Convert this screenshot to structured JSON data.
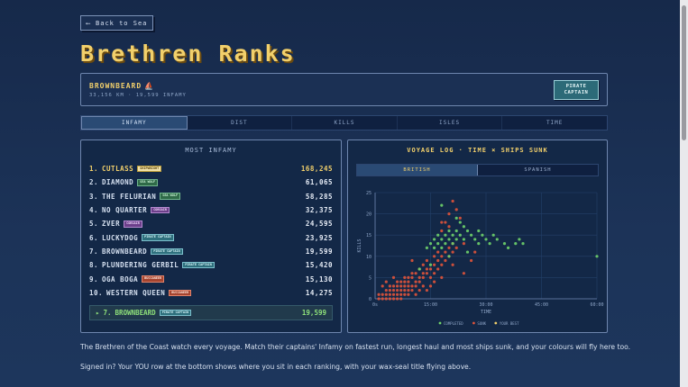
{
  "nav": {
    "back_label": "⟵ Back to Sea"
  },
  "page": {
    "title": "Brethren Ranks"
  },
  "user": {
    "name": "BROWNBEARD",
    "stats": "33,156 KM · 19,599 INFAMY",
    "rank_button": "PIRATE CAPTAIN"
  },
  "tabs": [
    {
      "label": "INFAMY",
      "active": true
    },
    {
      "label": "DIST",
      "active": false
    },
    {
      "label": "KILLS",
      "active": false
    },
    {
      "label": "ISLES",
      "active": false
    },
    {
      "label": "TIME",
      "active": false
    }
  ],
  "leaderboard": {
    "title": "MOST INFAMY",
    "rows": [
      {
        "rank": "1.",
        "name": "CUTLASS",
        "badge": "SHIPWRIGHT",
        "badge_style": "gold",
        "score": "168,245"
      },
      {
        "rank": "2.",
        "name": "DIAMOND",
        "badge": "SEA WOLF",
        "badge_style": "green",
        "score": "61,065"
      },
      {
        "rank": "3.",
        "name": "THE FELURIAN",
        "badge": "SEA WOLF",
        "badge_style": "green",
        "score": "58,285"
      },
      {
        "rank": "4.",
        "name": "NO QUARTER",
        "badge": "CORSAIR",
        "badge_style": "purple",
        "score": "32,375"
      },
      {
        "rank": "5.",
        "name": "ZVER",
        "badge": "CORSAIR",
        "badge_style": "purple",
        "score": "24,595"
      },
      {
        "rank": "6.",
        "name": "LUCKYDOG",
        "badge": "PIRATE CAPTAIN",
        "badge_style": "teal",
        "score": "23,925"
      },
      {
        "rank": "7.",
        "name": "BROWNBEARD",
        "badge": "PIRATE CAPTAIN",
        "badge_style": "teal",
        "score": "19,599"
      },
      {
        "rank": "8.",
        "name": "PLUNDERING GERBIL",
        "badge": "PIRATE CAPTAIN",
        "badge_style": "teal",
        "score": "15,420"
      },
      {
        "rank": "9.",
        "name": "OGA BOGA",
        "badge": "BUCCANEER",
        "badge_style": "red",
        "score": "15,130"
      },
      {
        "rank": "10.",
        "name": "WESTERN QUEEN",
        "badge": "BUCCANEER",
        "badge_style": "red",
        "score": "14,275"
      }
    ],
    "you_row": {
      "marker": "▸",
      "rank": "7.",
      "name": "BROWNBEARD",
      "badge": "PIRATE CAPTAIN",
      "score": "19,599"
    }
  },
  "voyage": {
    "title": "VOYAGE LOG · TIME × SHIPS SUNK",
    "segments": [
      {
        "label": "BRITISH",
        "active": true
      },
      {
        "label": "SPANISH",
        "active": false
      }
    ]
  },
  "chart_data": {
    "type": "scatter",
    "title": "VOYAGE LOG · TIME × SHIPS SUNK",
    "xlabel": "TIME",
    "ylabel": "KILLS",
    "x_ticks": [
      "0s",
      "15:00",
      "30:00",
      "45:00",
      "60:00"
    ],
    "y_ticks": [
      0,
      5,
      10,
      15,
      20,
      25
    ],
    "xlim": [
      0,
      60
    ],
    "ylim": [
      0,
      25
    ],
    "grid": true,
    "legend_placement": "bottom",
    "series": [
      {
        "name": "COMPLETED",
        "color": "#6fd36a",
        "points": [
          [
            14,
            12
          ],
          [
            15,
            13
          ],
          [
            16,
            14
          ],
          [
            16,
            12
          ],
          [
            17,
            13
          ],
          [
            17,
            15
          ],
          [
            18,
            14
          ],
          [
            18,
            12
          ],
          [
            19,
            13
          ],
          [
            19,
            15
          ],
          [
            20,
            14
          ],
          [
            20,
            16
          ],
          [
            21,
            13
          ],
          [
            21,
            15
          ],
          [
            22,
            14
          ],
          [
            22,
            16
          ],
          [
            23,
            15
          ],
          [
            24,
            14
          ],
          [
            24,
            17
          ],
          [
            25,
            16
          ],
          [
            26,
            15
          ],
          [
            27,
            14
          ],
          [
            28,
            13
          ],
          [
            28,
            16
          ],
          [
            29,
            15
          ],
          [
            30,
            14
          ],
          [
            31,
            13
          ],
          [
            32,
            15
          ],
          [
            33,
            14
          ],
          [
            35,
            13
          ],
          [
            36,
            12
          ],
          [
            38,
            13
          ],
          [
            39,
            14
          ],
          [
            40,
            13
          ],
          [
            18,
            22
          ],
          [
            22,
            19
          ],
          [
            20,
            10
          ],
          [
            25,
            11
          ],
          [
            15,
            8
          ],
          [
            60,
            10
          ],
          [
            12,
            7
          ],
          [
            23,
            18
          ]
        ]
      },
      {
        "name": "SUNK",
        "color": "#e0533a",
        "points": [
          [
            1,
            0
          ],
          [
            2,
            0
          ],
          [
            2,
            1
          ],
          [
            3,
            0
          ],
          [
            3,
            1
          ],
          [
            3,
            2
          ],
          [
            4,
            0
          ],
          [
            4,
            1
          ],
          [
            4,
            2
          ],
          [
            4,
            3
          ],
          [
            5,
            0
          ],
          [
            5,
            1
          ],
          [
            5,
            2
          ],
          [
            5,
            3
          ],
          [
            6,
            0
          ],
          [
            6,
            1
          ],
          [
            6,
            2
          ],
          [
            6,
            3
          ],
          [
            6,
            4
          ],
          [
            7,
            0
          ],
          [
            7,
            1
          ],
          [
            7,
            2
          ],
          [
            7,
            3
          ],
          [
            7,
            4
          ],
          [
            8,
            1
          ],
          [
            8,
            2
          ],
          [
            8,
            3
          ],
          [
            8,
            4
          ],
          [
            8,
            5
          ],
          [
            9,
            2
          ],
          [
            9,
            3
          ],
          [
            9,
            4
          ],
          [
            9,
            5
          ],
          [
            10,
            2
          ],
          [
            10,
            3
          ],
          [
            10,
            5
          ],
          [
            10,
            6
          ],
          [
            11,
            3
          ],
          [
            11,
            4
          ],
          [
            11,
            6
          ],
          [
            12,
            4
          ],
          [
            12,
            5
          ],
          [
            12,
            7
          ],
          [
            13,
            5
          ],
          [
            13,
            6
          ],
          [
            13,
            8
          ],
          [
            14,
            6
          ],
          [
            14,
            7
          ],
          [
            14,
            9
          ],
          [
            15,
            5
          ],
          [
            15,
            7
          ],
          [
            16,
            6
          ],
          [
            16,
            8
          ],
          [
            16,
            10
          ],
          [
            17,
            7
          ],
          [
            17,
            9
          ],
          [
            17,
            11
          ],
          [
            18,
            8
          ],
          [
            18,
            10
          ],
          [
            18,
            16
          ],
          [
            19,
            9
          ],
          [
            19,
            11
          ],
          [
            19,
            18
          ],
          [
            20,
            10
          ],
          [
            20,
            12
          ],
          [
            20,
            20
          ],
          [
            21,
            11
          ],
          [
            21,
            13
          ],
          [
            21,
            23
          ],
          [
            22,
            12
          ],
          [
            22,
            21
          ],
          [
            23,
            19
          ],
          [
            24,
            13
          ],
          [
            26,
            9
          ],
          [
            27,
            11
          ],
          [
            12,
            2
          ],
          [
            15,
            3
          ],
          [
            18,
            5
          ],
          [
            21,
            8
          ],
          [
            24,
            6
          ],
          [
            2,
            3
          ],
          [
            3,
            4
          ],
          [
            1,
            1
          ],
          [
            5,
            5
          ],
          [
            10,
            9
          ],
          [
            13,
            3
          ],
          [
            16,
            4
          ],
          [
            9,
            1
          ],
          [
            11,
            1
          ],
          [
            14,
            2
          ],
          [
            20,
            17
          ],
          [
            18,
            18
          ]
        ]
      },
      {
        "name": "YOUR BEST",
        "color": "#f2d06b",
        "points": []
      }
    ]
  }
}
